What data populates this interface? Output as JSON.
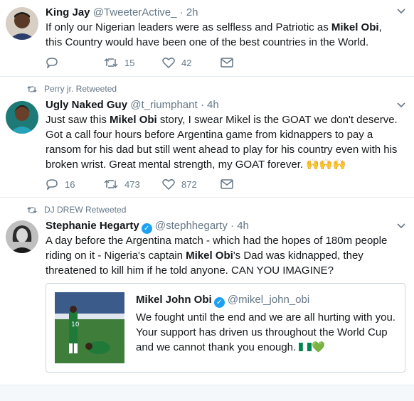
{
  "tweets": [
    {
      "name": "King Jay",
      "handle": "@TweeterActive_",
      "time": "2h",
      "text_parts": [
        "If only our Nigerian leaders were as selfless and Patriotic as ",
        "Mikel Obi",
        ", this Country would have been one of the best countries in the World."
      ],
      "replies": "",
      "retweets": "15",
      "likes": "42"
    },
    {
      "context": "Perry jr. Retweeted",
      "name": "Ugly Naked Guy",
      "handle": "@t_riumphant",
      "time": "4h",
      "text_parts": [
        "Just saw this ",
        "Mikel Obi",
        " story, I swear Mikel is the GOAT we don't deserve. Got a call four hours before Argentina game from kidnappers to pay a ransom for his dad but still went ahead to play for his country even with his broken wrist. Great mental strength, my GOAT forever. ",
        "🙌🙌🙌"
      ],
      "replies": "16",
      "retweets": "473",
      "likes": "872"
    },
    {
      "context": "DJ DREW Retweeted",
      "name": "Stephanie Hegarty",
      "handle": "@stephhegarty",
      "time": "4h",
      "text_parts": [
        "A day before the Argentina match - which had the hopes of 180m people riding on it - Nigeria's captain ",
        "Mikel Obi",
        "'s Dad was kidnapped, they threatened to kill him if he told anyone. CAN YOU IMAGINE?"
      ],
      "quote": {
        "name": "Mikel John Obi",
        "handle": "@mikel_john_obi",
        "text": "We fought until the end and we are all hurting with you. Your support has driven us throughout the World Cup and we cannot thank you enough. "
      }
    }
  ],
  "separator_dot": "·",
  "colors": {
    "muted": "#657786",
    "accent": "#1da1f2",
    "border": "#e6ecf0"
  }
}
